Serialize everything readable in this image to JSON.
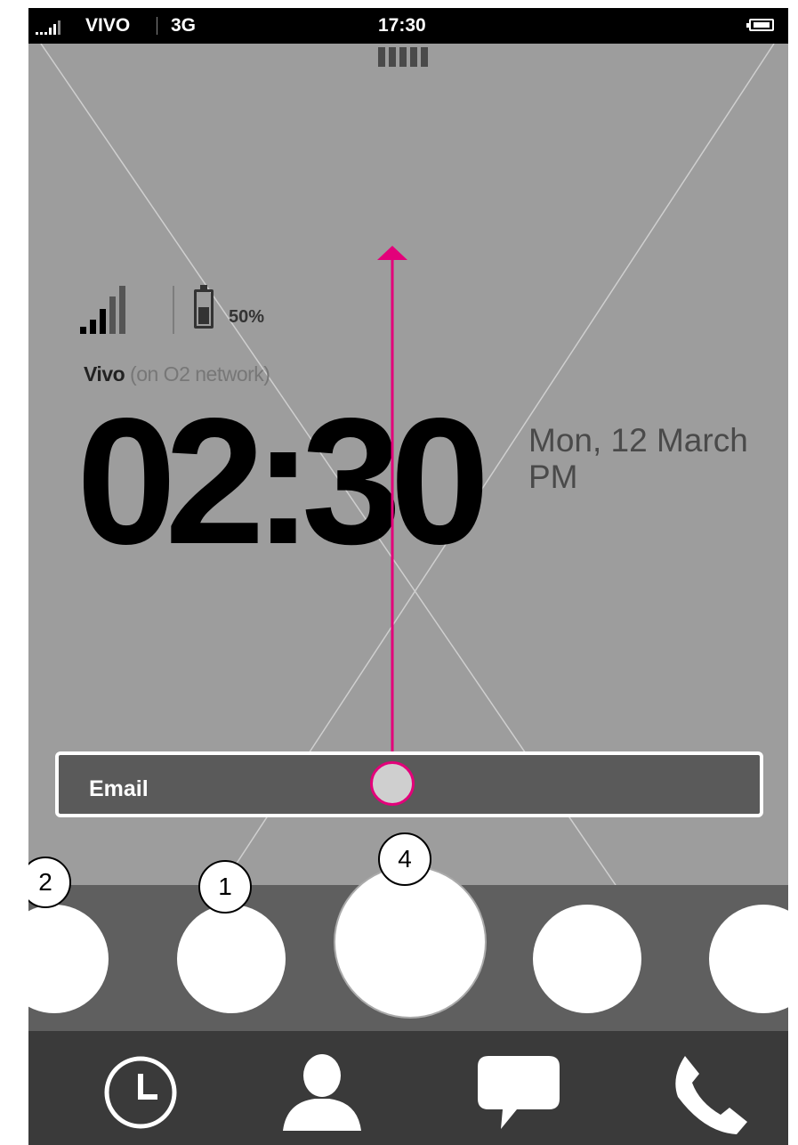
{
  "status_bar": {
    "carrier": "VIVO",
    "network": "3G",
    "time": "17:30"
  },
  "lock_screen": {
    "battery_percent": "50%",
    "carrier_name": "Vivo",
    "carrier_network": "(on O2 network)",
    "time": "02:30",
    "date": "Mon, 12 March",
    "am_pm": "PM"
  },
  "notification": {
    "label": "Email"
  },
  "app_tray": {
    "badges": [
      "2",
      "1",
      "4"
    ]
  },
  "dock": {
    "icons": [
      "clock-icon",
      "contact-icon",
      "message-icon",
      "phone-icon"
    ]
  },
  "colors": {
    "background": "#9d9d9d",
    "accent": "#e3007a",
    "tray": "#5f5f5f",
    "dock": "#3a3a3a"
  }
}
